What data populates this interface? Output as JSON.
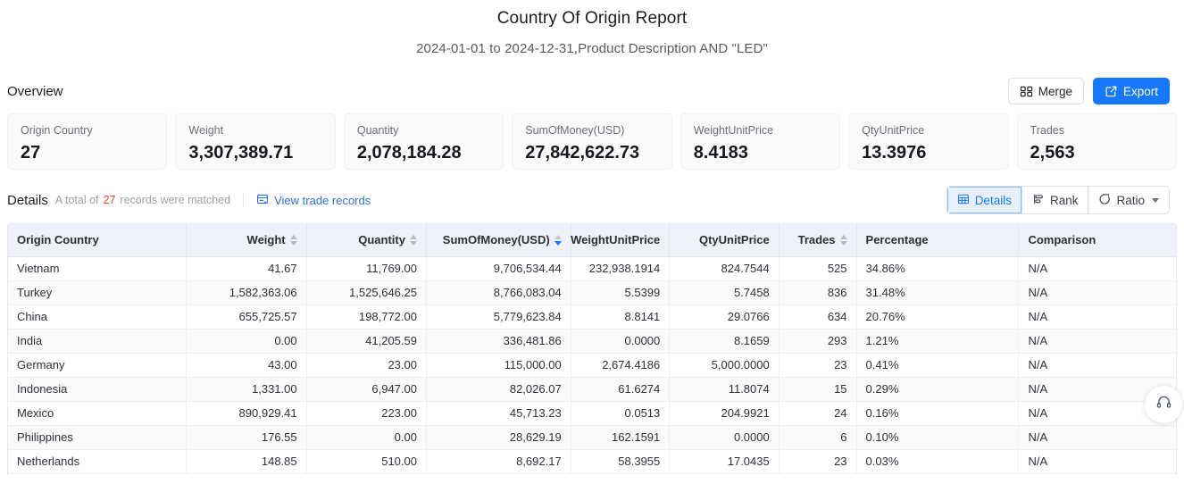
{
  "header": {
    "title": "Country Of Origin Report",
    "subtitle": "2024-01-01 to 2024-12-31,Product Description AND \"LED\""
  },
  "overview": {
    "label": "Overview",
    "merge_label": "Merge",
    "merge_icon": "merge-cells-icon",
    "export_label": "Export",
    "export_icon": "external-link-icon",
    "cards": [
      {
        "label": "Origin Country",
        "value": "27"
      },
      {
        "label": "Weight",
        "value": "3,307,389.71"
      },
      {
        "label": "Quantity",
        "value": "2,078,184.28"
      },
      {
        "label": "SumOfMoney(USD)",
        "value": "27,842,622.73"
      },
      {
        "label": "WeightUnitPrice",
        "value": "8.4183"
      },
      {
        "label": "QtyUnitPrice",
        "value": "13.3976"
      },
      {
        "label": "Trades",
        "value": "2,563"
      }
    ]
  },
  "details": {
    "title": "Details",
    "meta_prefix": "A total of",
    "record_count": "27",
    "meta_suffix": "records were matched",
    "view_records_label": "View trade records",
    "view_records_icon": "records-list-icon",
    "view_toggle": [
      {
        "label": "Details",
        "icon": "table-grid-icon",
        "active": true
      },
      {
        "label": "Rank",
        "icon": "rank-bars-icon",
        "active": false
      },
      {
        "label": "Ratio",
        "icon": "ratio-donut-icon",
        "active": false,
        "has_caret": true
      }
    ]
  },
  "table": {
    "columns": [
      {
        "key": "country",
        "label": "Origin Country",
        "align": "left",
        "sortable": false,
        "sort": "none",
        "width": "16.8%"
      },
      {
        "key": "weight",
        "label": "Weight",
        "align": "right",
        "sortable": true,
        "sort": "none",
        "width": "11.3%"
      },
      {
        "key": "quantity",
        "label": "Quantity",
        "align": "right",
        "sortable": true,
        "sort": "none",
        "width": "11.3%"
      },
      {
        "key": "sum_of_money",
        "label": "SumOfMoney(USD)",
        "align": "right",
        "sortable": true,
        "sort": "desc",
        "width": "13.6%"
      },
      {
        "key": "weight_unit",
        "label": "WeightUnitPrice",
        "align": "right",
        "sortable": false,
        "sort": "none",
        "width": "9.3%"
      },
      {
        "key": "qty_unit",
        "label": "QtyUnitPrice",
        "align": "right",
        "sortable": false,
        "sort": "none",
        "width": "10.3%"
      },
      {
        "key": "trades",
        "label": "Trades",
        "align": "right",
        "sortable": true,
        "sort": "none",
        "width": "7.3%"
      },
      {
        "key": "percentage",
        "label": "Percentage",
        "align": "left",
        "sortable": false,
        "sort": "none",
        "width": "15.3%"
      },
      {
        "key": "comparison",
        "label": "Comparison",
        "align": "left",
        "sortable": false,
        "sort": "none",
        "width": "14.8%"
      }
    ],
    "rows": [
      {
        "country": "Vietnam",
        "weight": "41.67",
        "quantity": "11,769.00",
        "sum_of_money": "9,706,534.44",
        "weight_unit": "232,938.1914",
        "qty_unit": "824.7544",
        "trades": "525",
        "percentage": "34.86%",
        "comparison": "N/A"
      },
      {
        "country": "Turkey",
        "weight": "1,582,363.06",
        "quantity": "1,525,646.25",
        "sum_of_money": "8,766,083.04",
        "weight_unit": "5.5399",
        "qty_unit": "5.7458",
        "trades": "836",
        "percentage": "31.48%",
        "comparison": "N/A"
      },
      {
        "country": "China",
        "weight": "655,725.57",
        "quantity": "198,772.00",
        "sum_of_money": "5,779,623.84",
        "weight_unit": "8.8141",
        "qty_unit": "29.0766",
        "trades": "634",
        "percentage": "20.76%",
        "comparison": "N/A"
      },
      {
        "country": "India",
        "weight": "0.00",
        "quantity": "41,205.59",
        "sum_of_money": "336,481.86",
        "weight_unit": "0.0000",
        "qty_unit": "8.1659",
        "trades": "293",
        "percentage": "1.21%",
        "comparison": "N/A"
      },
      {
        "country": "Germany",
        "weight": "43.00",
        "quantity": "23.00",
        "sum_of_money": "115,000.00",
        "weight_unit": "2,674.4186",
        "qty_unit": "5,000.0000",
        "trades": "23",
        "percentage": "0.41%",
        "comparison": "N/A"
      },
      {
        "country": "Indonesia",
        "weight": "1,331.00",
        "quantity": "6,947.00",
        "sum_of_money": "82,026.07",
        "weight_unit": "61.6274",
        "qty_unit": "11.8074",
        "trades": "15",
        "percentage": "0.29%",
        "comparison": "N/A"
      },
      {
        "country": "Mexico",
        "weight": "890,929.41",
        "quantity": "223.00",
        "sum_of_money": "45,713.23",
        "weight_unit": "0.0513",
        "qty_unit": "204.9921",
        "trades": "24",
        "percentage": "0.16%",
        "comparison": "N/A"
      },
      {
        "country": "Philippines",
        "weight": "176.55",
        "quantity": "0.00",
        "sum_of_money": "28,629.19",
        "weight_unit": "162.1591",
        "qty_unit": "0.0000",
        "trades": "6",
        "percentage": "0.10%",
        "comparison": "N/A"
      },
      {
        "country": "Netherlands",
        "weight": "148.85",
        "quantity": "510.00",
        "sum_of_money": "8,692.17",
        "weight_unit": "58.3955",
        "qty_unit": "17.0435",
        "trades": "23",
        "percentage": "0.03%",
        "comparison": "N/A"
      }
    ]
  },
  "support": {
    "icon": "headset-icon"
  },
  "colors": {
    "primary": "#1677ff",
    "link": "#2f6fe4",
    "danger": "#e8453c",
    "header_bg": "#eef1f9",
    "card_bg": "#fafafa"
  }
}
